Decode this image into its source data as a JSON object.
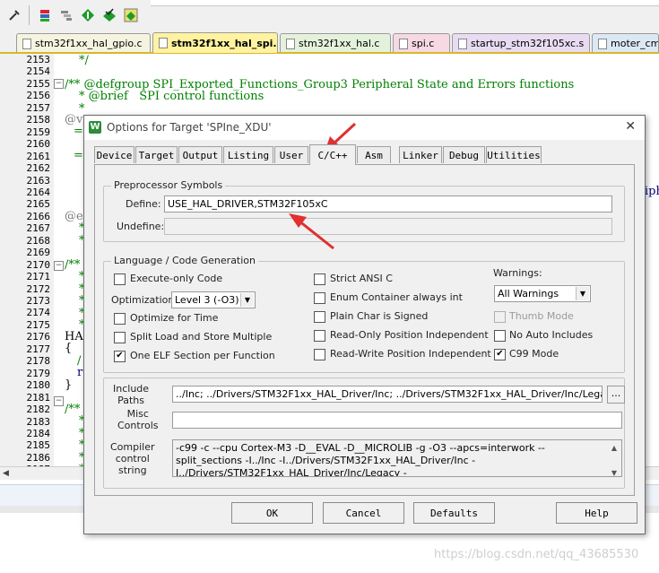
{
  "toolbar": {
    "icons": [
      "tools-icon",
      "stack-icon",
      "list-icon",
      "green-diamond-icon",
      "check-diamond-icon",
      "manage-icon"
    ]
  },
  "editor_tabs": [
    {
      "label": "stm32f1xx_hal_gpio.c",
      "color": "#f4f4e0"
    },
    {
      "label": "stm32f1xx_hal_spi.c",
      "color": "#fff3a0",
      "active": true
    },
    {
      "label": "stm32f1xx_hal.c",
      "color": "#e4f2dc"
    },
    {
      "label": "spi.c",
      "color": "#f6d9e2"
    },
    {
      "label": "startup_stm32f105xc.s",
      "color": "#e9dcf2"
    },
    {
      "label": "moter_cm",
      "color": "#dde8f5"
    }
  ],
  "editor": {
    "line_numbers": [
      "2153",
      "2154",
      "2155",
      "2156",
      "2157",
      "2158",
      "2159",
      "2160",
      "2161",
      "2162",
      "2163",
      "2164",
      "2165",
      "2166",
      "2167",
      "2168",
      "2169",
      "2170",
      "2171",
      "2172",
      "2173",
      "2174",
      "2175",
      "2176",
      "2177",
      "2178",
      "2179",
      "2180",
      "2181",
      "2182",
      "2183",
      "2184",
      "2185",
      "2186",
      "2187"
    ],
    "code": {
      "l2153": "*/",
      "l2155": "/** @defgroup SPI_Exported_Functions_Group3 Peripheral State and Errors functions",
      "l2156": "* @brief   SPI control functions",
      "l2157": "*",
      "l2158": "@ve",
      "l2159": "==",
      "l2161": "==",
      "l2164_right": "iph",
      "l2166": "@en",
      "l2167": "*",
      "l2168": "*",
      "l2170": "/**",
      "l2171": "*",
      "l2172": "*",
      "l2173": "*",
      "l2174": "*",
      "l2175": "*",
      "l2176": "HAL",
      "l2177": "{",
      "l2178": "/",
      "l2179": "r",
      "l2180": "}",
      "l2182": "/**",
      "l2183": "*",
      "l2184": "*",
      "l2185": "*",
      "l2186": "*",
      "l2187": "*"
    }
  },
  "watermark": "https://blog.csdn.net/qq_43685530",
  "dialog": {
    "title": "Options for Target 'SPIne_XDU'",
    "close_glyph": "✕",
    "app_icon": "W",
    "tabs": [
      "Device",
      "Target",
      "Output",
      "Listing",
      "User",
      "C/C++",
      "Asm",
      "Linker",
      "Debug",
      "Utilities"
    ],
    "active_tab": "C/C++",
    "preprocessor": {
      "title": "Preprocessor Symbols",
      "define_label": "Define:",
      "define_value": "USE_HAL_DRIVER,STM32F105xC",
      "undefine_label": "Undefine:",
      "undefine_value": ""
    },
    "language": {
      "title": "Language / Code Generation",
      "execute_only": "Execute-only Code",
      "optimization_label": "Optimization:",
      "optimization_value": "Level 3 (-O3)",
      "optimize_time": "Optimize for Time",
      "split_load": "Split Load and Store Multiple",
      "one_elf": "One ELF Section per Function",
      "strict_ansi": "Strict ANSI C",
      "enum_container": "Enum Container always int",
      "plain_char": "Plain Char is Signed",
      "ro_pi": "Read-Only Position Independent",
      "rw_pi": "Read-Write Position Independent",
      "warnings_label": "Warnings:",
      "warnings_value": "All Warnings",
      "thumb_mode": "Thumb Mode",
      "no_auto_includes": "No Auto Includes",
      "c99_mode": "C99 Mode",
      "checked_glyph": "✔"
    },
    "include_paths_label": "Include\nPaths",
    "include_paths_value": "../Inc;   ../Drivers/STM32F1xx_HAL_Driver/Inc;   ../Drivers/STM32F1xx_HAL_Driver/Inc/Legacy;",
    "browse_label": "...",
    "misc_label": "Misc\nControls",
    "misc_value": "",
    "compiler_label": "Compiler\ncontrol\nstring",
    "compiler_value": "-c99 -c --cpu Cortex-M3 -D__EVAL -D__MICROLIB -g -O3 --apcs=interwork --split_sections -I../Inc -I../Drivers/STM32F1xx_HAL_Driver/Inc -I../Drivers/STM32F1xx_HAL_Driver/Inc/Legacy -",
    "buttons": {
      "ok": "OK",
      "cancel": "Cancel",
      "defaults": "Defaults",
      "help": "Help"
    }
  },
  "annotation_color": "#e03030"
}
